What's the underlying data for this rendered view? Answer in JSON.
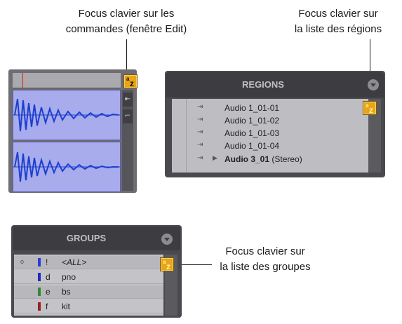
{
  "callouts": {
    "edit": {
      "line1": "Focus clavier sur les",
      "line2": "commandes (fenêtre Edit)"
    },
    "regions": {
      "line1": "Focus clavier sur",
      "line2": "la liste des régions"
    },
    "groups": {
      "line1": "Focus clavier sur",
      "line2": "la liste des groupes"
    }
  },
  "focus_badge": {
    "top_letter": "a",
    "main_letter": "z",
    "color": "#e9a515"
  },
  "edit_window": {
    "side_buttons": [
      "⇤",
      "⌐"
    ],
    "track_color": "#a9acec",
    "waveform_color": "#1c3fd0",
    "playhead_color": "#d32020"
  },
  "regions": {
    "title": "REGIONS",
    "rows": [
      {
        "name": "Audio 1_01-01",
        "suffix": "",
        "bold": false,
        "expandable": false
      },
      {
        "name": "Audio 1_01-02",
        "suffix": "",
        "bold": false,
        "expandable": false
      },
      {
        "name": "Audio 1_01-03",
        "suffix": "",
        "bold": false,
        "expandable": false
      },
      {
        "name": "Audio 1_01-04",
        "suffix": "",
        "bold": false,
        "expandable": false
      },
      {
        "name": "Audio 3_01",
        "suffix": " (Stereo)",
        "bold": true,
        "expandable": true
      }
    ],
    "grip_icon": "⇥",
    "expand_icon": "▶"
  },
  "groups": {
    "title": "GROUPS",
    "rows": [
      {
        "key": "!",
        "name": "<ALL>",
        "color": "#2d3bd6",
        "marker": "o",
        "italic": true
      },
      {
        "key": "d",
        "name": "pno",
        "color": "#1f2ab8",
        "marker": "",
        "italic": false
      },
      {
        "key": "e",
        "name": "bs",
        "color": "#2f8a2f",
        "marker": "",
        "italic": false
      },
      {
        "key": "f",
        "name": "kit",
        "color": "#9b1f1f",
        "marker": "",
        "italic": false
      }
    ]
  }
}
